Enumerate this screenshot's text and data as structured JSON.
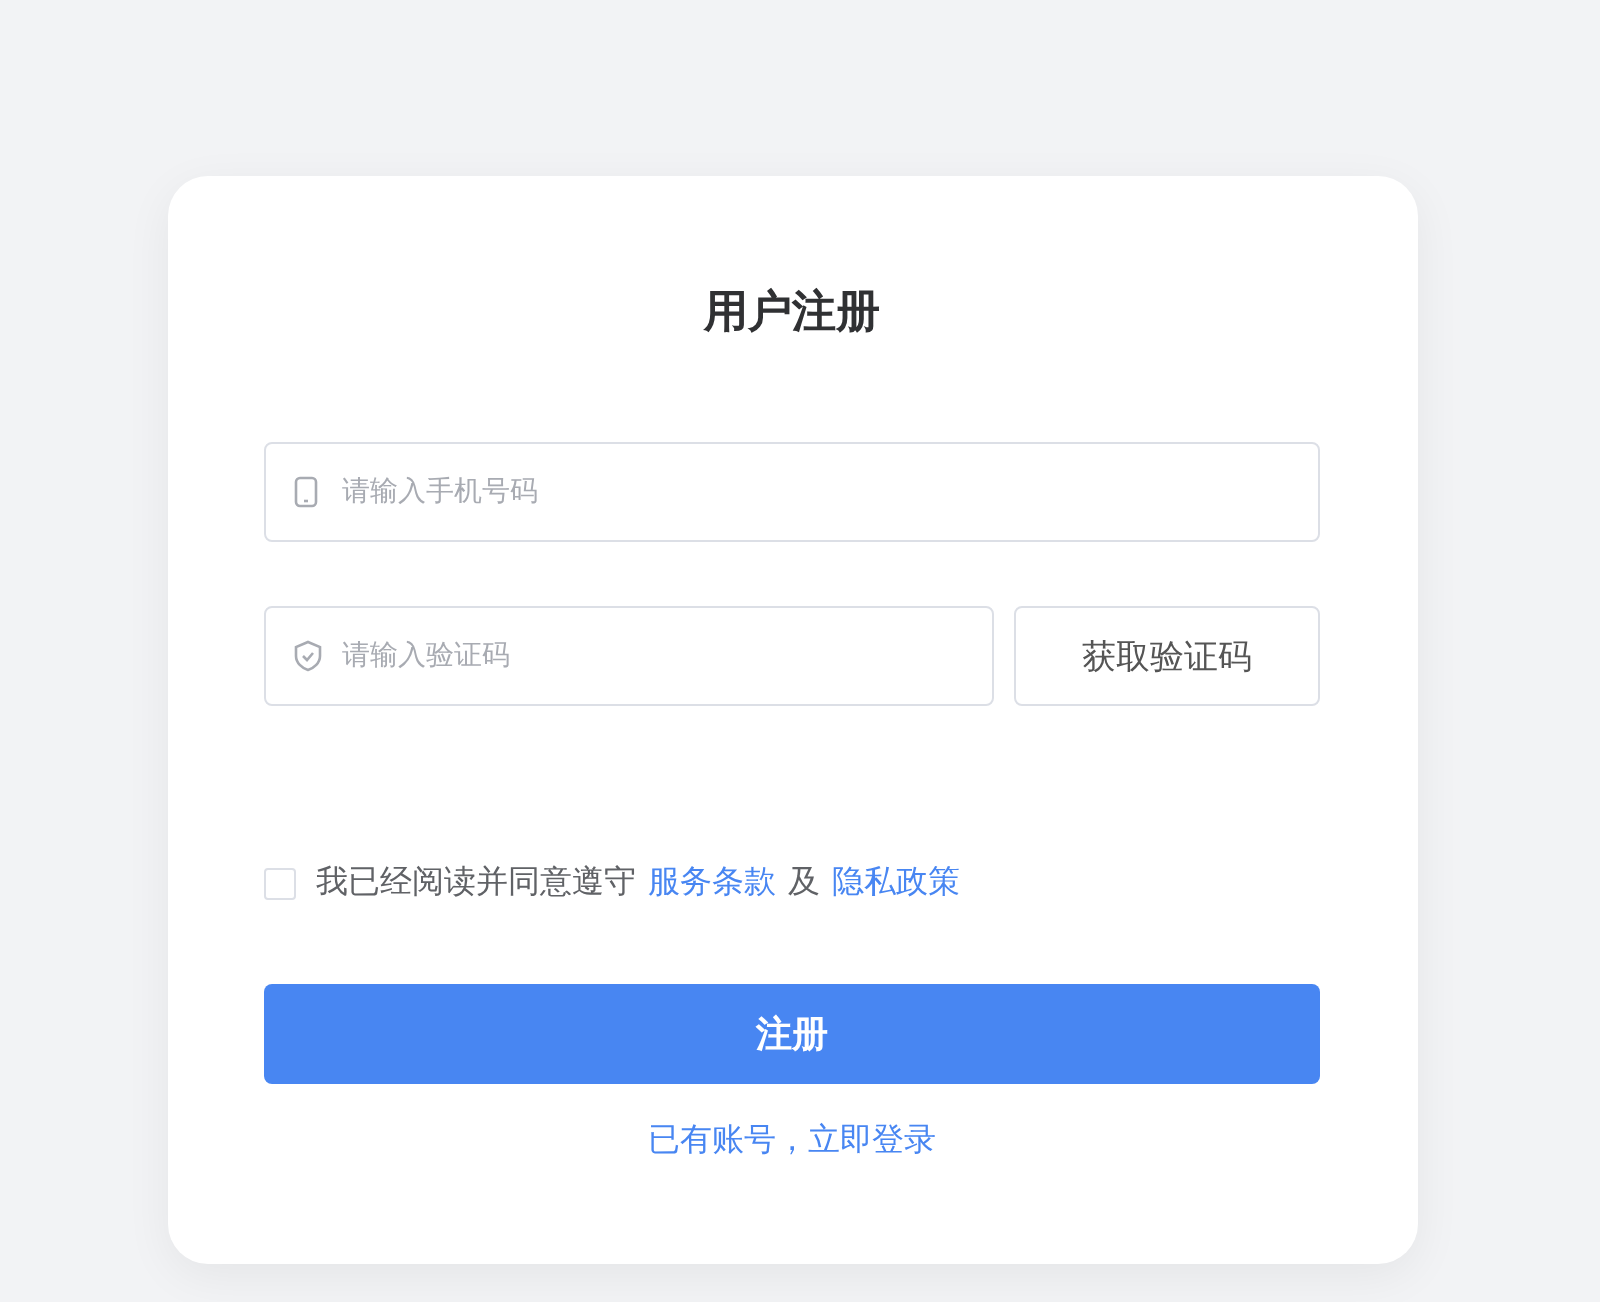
{
  "title": "用户注册",
  "phone_field": {
    "placeholder": "请输入手机号码"
  },
  "code_field": {
    "placeholder": "请输入验证码"
  },
  "code_button": "获取验证码",
  "agreement": {
    "checked": false,
    "text": "我已经阅读并同意遵守",
    "terms_link": "服务条款",
    "conjunction": "及",
    "privacy_link": "隐私政策"
  },
  "submit_button": "注册",
  "login_link": "已有账号，立即登录"
}
